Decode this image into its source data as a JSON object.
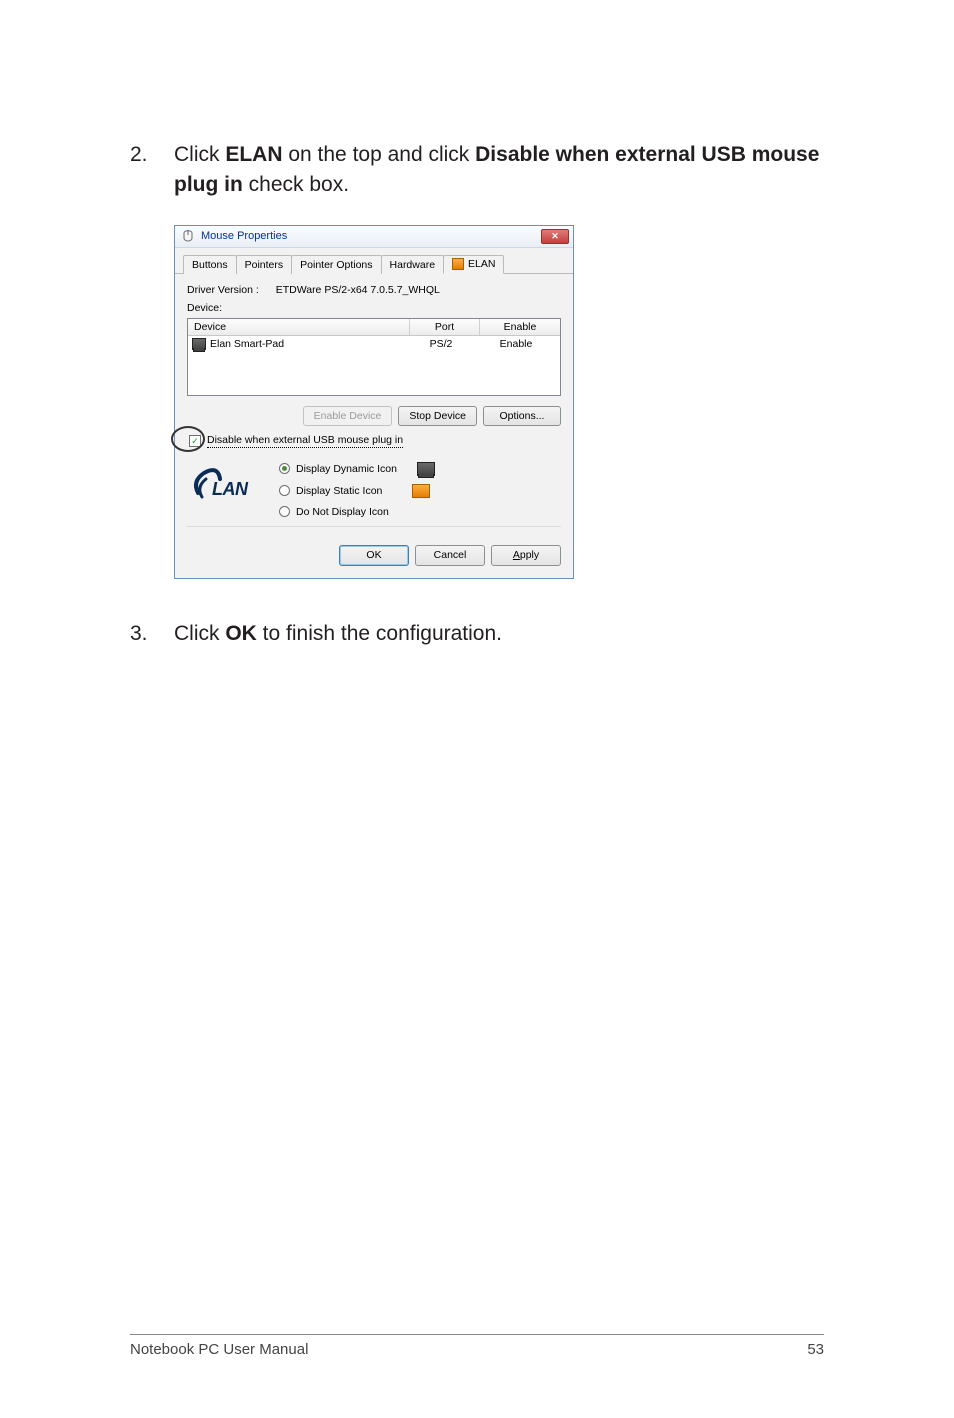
{
  "steps": {
    "s2_num": "2.",
    "s2_a": "Click ",
    "s2_b": "ELAN",
    "s2_c": " on the top and click ",
    "s2_d": "Disable when external USB mouse plug in",
    "s2_e": " check box.",
    "s3_num": "3.",
    "s3_a": "Click ",
    "s3_b": "OK",
    "s3_c": " to finish the configuration."
  },
  "dialog": {
    "title": "Mouse Properties",
    "tabs": {
      "buttons": "Buttons",
      "pointers": "Pointers",
      "pointer_options": "Pointer Options",
      "hardware": "Hardware",
      "elan": "ELAN"
    },
    "driver_version_label": "Driver Version :",
    "driver_version_value": "ETDWare PS/2-x64 7.0.5.7_WHQL",
    "device_label": "Device:",
    "columns": {
      "device": "Device",
      "port": "Port",
      "enable": "Enable"
    },
    "row": {
      "name": "Elan Smart-Pad",
      "port": "PS/2",
      "enable": "Enable"
    },
    "btns": {
      "enable_device": "Enable Device",
      "stop_device": "Stop Device",
      "options": "Options..."
    },
    "checkbox_label": "Disable when external USB mouse plug in",
    "radios": {
      "dynamic": "Display Dynamic Icon",
      "static": "Display Static Icon",
      "none": "Do Not Display Icon"
    },
    "logo_text": "LAN",
    "footer_btns": {
      "ok": "OK",
      "cancel": "Cancel",
      "apply_pre": "A",
      "apply_rest": "pply"
    }
  },
  "footer": {
    "left": "Notebook PC User Manual",
    "right": "53"
  }
}
